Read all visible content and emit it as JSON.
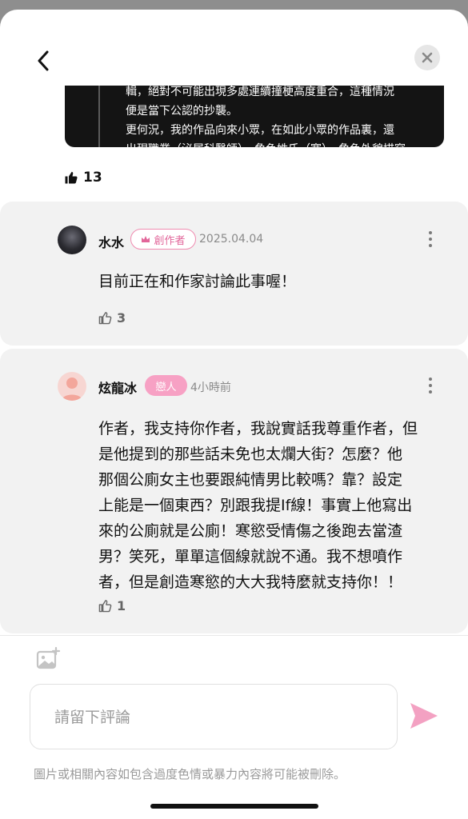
{
  "header": {
    "back_icon": "chevron-left-icon",
    "close_icon": "close-icon"
  },
  "quote": {
    "lines": [
      "輯，絕對不可能出現多處連續撞梗高度重合，這種情況",
      "便是當下公認的抄襲。",
      "更何況，我的作品向來小眾，在如此小眾的作品裏，還",
      "出現職業（泌尿科醫師）、角色姓氏（寒）、角色外貌描寫"
    ]
  },
  "post": {
    "like_count": "13"
  },
  "comments": [
    {
      "author": "水水",
      "badge": "創作者",
      "time": "2025.04.04",
      "text": "目前正在和作家討論此事喔！",
      "likes": "3"
    },
    {
      "author": "炫龍冰",
      "badge": "戀人",
      "time": "4小時前",
      "text_lines": [
        "作者，我支持你作者，我說實話我尊重作者，但",
        "是他提到的那些話未免也太爛大街？怎麼？他",
        "那個公廁女主也要跟純情男比較嗎？靠？設定",
        "上能是一個東西？別跟我提If線！事實上他寫出",
        "來的公廁就是公廁！寒慾受情傷之後跑去當渣",
        "男？笑死，單單這個線就說不通。我不想噴作",
        "者，但是創造寒慾的大大我特麼就支持你！！"
      ],
      "likes": "1"
    }
  ],
  "composer": {
    "placeholder": "請留下評論",
    "notice": "圖片或相關內容如包含過度色情或暴力內容將可能被刪除。"
  },
  "colors": {
    "accent_pink": "#f08bb0",
    "card_bg": "#f2f2f2"
  }
}
